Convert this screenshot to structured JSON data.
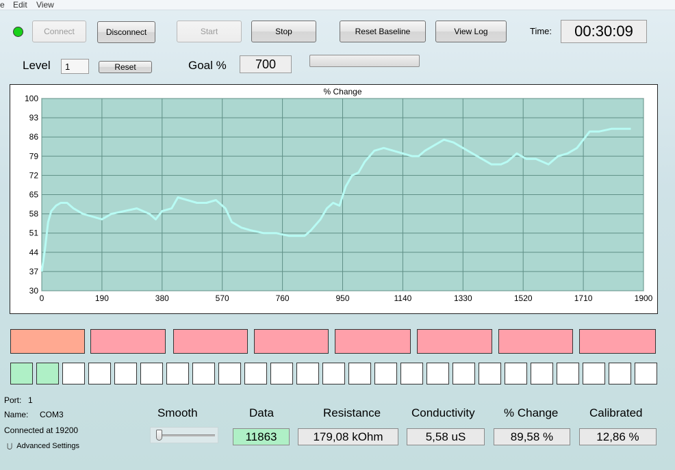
{
  "menu": {
    "file_partial": "e",
    "edit": "Edit",
    "view": "View"
  },
  "toolbar": {
    "status_color": "#19d11b",
    "connect": "Connect",
    "disconnect": "Disconnect",
    "start": "Start",
    "stop": "Stop",
    "reset_baseline": "Reset Baseline",
    "view_log": "View Log",
    "time_label": "Time:",
    "time_value": "00:30:09"
  },
  "level": {
    "label": "Level",
    "value": "1",
    "reset": "Reset"
  },
  "goal": {
    "label": "Goal %",
    "value": "700",
    "progress": 0
  },
  "chart_data": {
    "type": "line",
    "title": "% Change",
    "xlabel": "",
    "ylabel": "",
    "xlim": [
      0,
      1900
    ],
    "ylim": [
      30,
      100
    ],
    "xticks": [
      "0",
      "190",
      "380",
      "570",
      "760",
      "950",
      "1140",
      "1330",
      "1520",
      "1710",
      "1900"
    ],
    "yticks": [
      "100",
      "93",
      "86",
      "79",
      "72",
      "65",
      "58",
      "51",
      "44",
      "37",
      "30"
    ],
    "grid": true,
    "plot_bg": "#acd7d0",
    "line_color": "#b8fbf4",
    "series": [
      {
        "x": [
          0,
          10,
          20,
          30,
          45,
          60,
          80,
          100,
          130,
          160,
          190,
          220,
          260,
          300,
          340,
          360,
          380,
          410,
          430,
          460,
          490,
          520,
          550,
          580,
          600,
          630,
          660,
          700,
          740,
          780,
          800,
          830,
          850,
          880,
          900,
          920,
          940,
          960,
          980,
          1000,
          1020,
          1050,
          1080,
          1110,
          1140,
          1170,
          1190,
          1210,
          1240,
          1270,
          1300,
          1330,
          1360,
          1390,
          1420,
          1450,
          1470,
          1500,
          1530,
          1560,
          1580,
          1600,
          1630,
          1660,
          1690,
          1710,
          1730,
          1760,
          1800,
          1840,
          1860
        ],
        "y": [
          37,
          45,
          55,
          59,
          61,
          62,
          62,
          60,
          58,
          57,
          56,
          58,
          59,
          60,
          58,
          56,
          59,
          60,
          64,
          63,
          62,
          62,
          63,
          60,
          55,
          53,
          52,
          51,
          51,
          50,
          50,
          50,
          52,
          56,
          60,
          62,
          61,
          68,
          72,
          73,
          77,
          81,
          82,
          81,
          80,
          79,
          79,
          81,
          83,
          85,
          84,
          82,
          80,
          78,
          76,
          76,
          77,
          80,
          78,
          78,
          77,
          76,
          79,
          80,
          82,
          85,
          88,
          88,
          89,
          89,
          89
        ]
      }
    ]
  },
  "indicators": {
    "blocks": [
      "#ffa991",
      "#ffa0aa",
      "#ffa0aa",
      "#ffa0aa",
      "#ffa0aa",
      "#ffa0aa",
      "#ffa0aa",
      "#ffa0aa"
    ],
    "squares_on": 2,
    "squares_total": 25
  },
  "port": {
    "port_label": "Port:",
    "port_value": "1",
    "name_label": "Name:",
    "name_value": "COM3",
    "connected": "Connected at 19200",
    "advanced": "Advanced Settings"
  },
  "readouts": {
    "smooth_label": "Smooth",
    "smooth_level": 0,
    "data_label": "Data",
    "data_value": "11863",
    "resistance_label": "Resistance",
    "resistance_value": "179,08 kOhm",
    "conductivity_label": "Conductivity",
    "conductivity_value": "5,58 uS",
    "change_label": "% Change",
    "change_value": "89,58 %",
    "calibrated_label": "Calibrated",
    "calibrated_value": "12,86 %"
  }
}
